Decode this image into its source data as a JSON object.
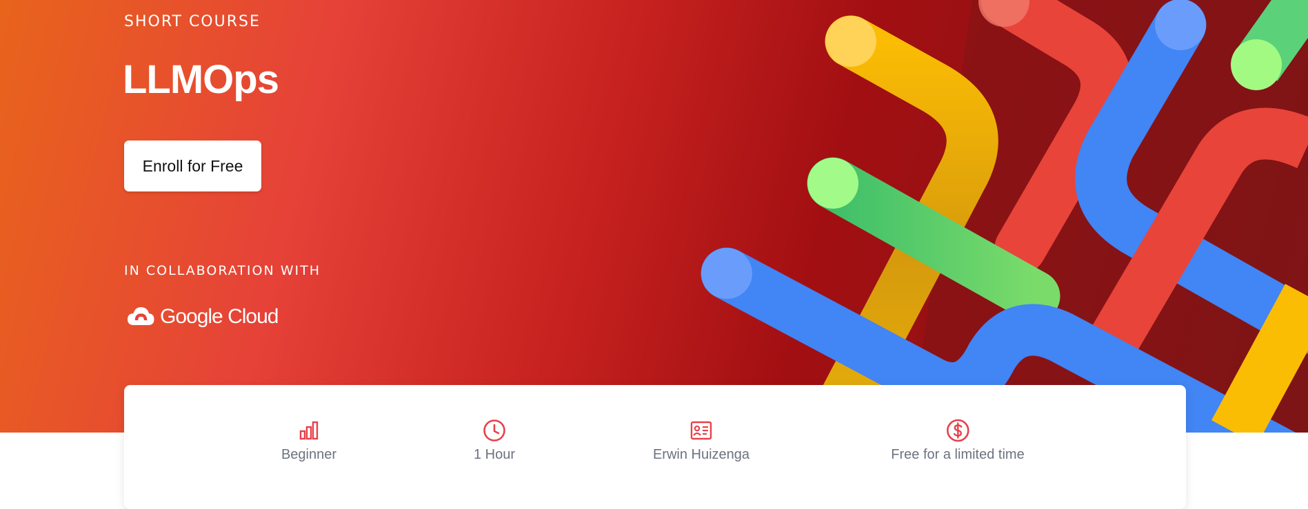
{
  "hero": {
    "eyebrow": "SHORT COURSE",
    "title": "LLMOps",
    "enroll_label": "Enroll for Free",
    "collab_label": "IN COLLABORATION WITH",
    "partner_name": "Google Cloud",
    "partner_icon": "google-cloud-logo"
  },
  "course_info": [
    {
      "icon": "bar-chart-icon",
      "label": "Beginner"
    },
    {
      "icon": "clock-icon",
      "label": "1 Hour"
    },
    {
      "icon": "instructor-card-icon",
      "label": "Erwin Huizenga"
    },
    {
      "icon": "dollar-icon",
      "label": "Free for a limited time"
    }
  ],
  "colors": {
    "accent": "#e8404a",
    "hero_start": "#e8641c",
    "hero_mid": "#e64238",
    "hero_end": "#7c1517",
    "stripe_yellow": "#fbbc04",
    "stripe_green": "#5bd17a",
    "stripe_blue": "#4285f4",
    "stripe_red": "#ea4335",
    "label_gray": "#6b7280"
  }
}
